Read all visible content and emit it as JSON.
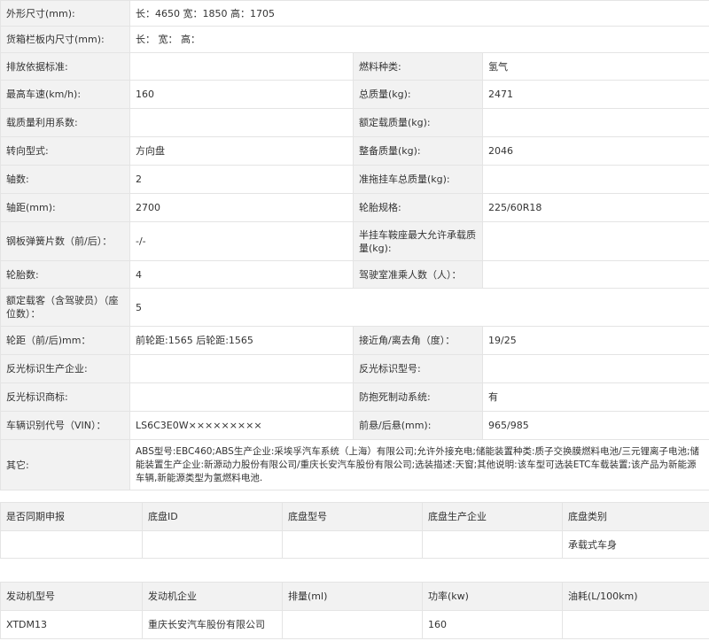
{
  "spec": {
    "dimensions": {
      "label": "外形尺寸(mm):",
      "value": "长：4650 宽：1850 高：1705"
    },
    "cargo_box": {
      "label": "货箱栏板内尺寸(mm):",
      "value": "长： 宽： 高："
    },
    "emission_std": {
      "label": "排放依据标准:",
      "value": ""
    },
    "fuel_type": {
      "label": "燃料种类:",
      "value": "氢气"
    },
    "max_speed": {
      "label": "最高车速(km/h):",
      "value": "160"
    },
    "total_mass": {
      "label": "总质量(kg):",
      "value": "2471"
    },
    "load_util": {
      "label": "载质量利用系数:",
      "value": ""
    },
    "rated_load": {
      "label": "额定载质量(kg):",
      "value": ""
    },
    "steering": {
      "label": "转向型式:",
      "value": "方向盘"
    },
    "curb_mass": {
      "label": "整备质量(kg):",
      "value": "2046"
    },
    "axles": {
      "label": "轴数:",
      "value": "2"
    },
    "trailer_mass": {
      "label": "准拖挂车总质量(kg):",
      "value": ""
    },
    "wheelbase": {
      "label": "轴距(mm):",
      "value": "2700"
    },
    "tire_spec": {
      "label": "轮胎规格:",
      "value": "225/60R18"
    },
    "leaf_springs": {
      "label": "钢板弹簧片数（前/后）：",
      "value": "-/-"
    },
    "saddle_load": {
      "label": "半挂车鞍座最大允许承载质量(kg):",
      "value": ""
    },
    "tire_count": {
      "label": "轮胎数:",
      "value": "4"
    },
    "cab_passengers": {
      "label": "驾驶室准乘人数（人）：",
      "value": ""
    },
    "rated_passengers": {
      "label": "额定载客（含驾驶员）（座位数）：",
      "value": "5"
    },
    "track": {
      "label": "轮距（前/后)mm：",
      "value": "前轮距:1565 后轮距:1565"
    },
    "approach_angle": {
      "label": "接近角/离去角（度）：",
      "value": "19/25"
    },
    "reflector_maker": {
      "label": "反光标识生产企业:",
      "value": ""
    },
    "reflector_model": {
      "label": "反光标识型号:",
      "value": ""
    },
    "reflector_brand": {
      "label": "反光标识商标:",
      "value": ""
    },
    "abs": {
      "label": "防抱死制动系统:",
      "value": "有"
    },
    "vin": {
      "label": "车辆识别代号（VIN）：",
      "value": "LS6C3E0W×××××××××"
    },
    "overhang": {
      "label": "前悬/后悬(mm):",
      "value": "965/985"
    },
    "other": {
      "label": "其它:",
      "value": "ABS型号:EBC460;ABS生产企业:采埃孚汽车系统（上海）有限公司;允许外接充电;储能装置种类:质子交换膜燃料电池/三元锂离子电池;储能装置生产企业:新源动力股份有限公司/重庆长安汽车股份有限公司;选装描述:天窗;其他说明:该车型可选装ETC车载装置;该产品为新能源车辆,新能源类型为氢燃料电池."
    }
  },
  "chassis": {
    "headers": [
      "是否同期申报",
      "底盘ID",
      "底盘型号",
      "底盘生产企业",
      "底盘类别"
    ],
    "row": [
      "",
      "",
      "",
      "",
      "承载式车身"
    ]
  },
  "engine": {
    "headers": [
      "发动机型号",
      "发动机企业",
      "排量(ml)",
      "功率(kw)",
      "油耗(L/100km)"
    ],
    "row": [
      "XTDM13",
      "重庆长安汽车股份有限公司",
      "",
      "160",
      ""
    ]
  }
}
